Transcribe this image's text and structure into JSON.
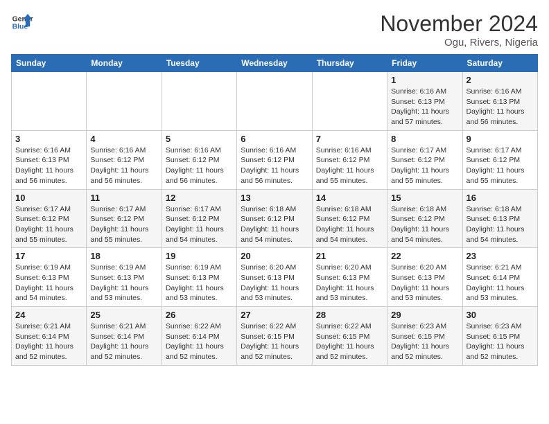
{
  "header": {
    "logo_line1": "General",
    "logo_line2": "Blue",
    "title": "November 2024",
    "subtitle": "Ogu, Rivers, Nigeria"
  },
  "weekdays": [
    "Sunday",
    "Monday",
    "Tuesday",
    "Wednesday",
    "Thursday",
    "Friday",
    "Saturday"
  ],
  "weeks": [
    [
      {
        "day": "",
        "info": ""
      },
      {
        "day": "",
        "info": ""
      },
      {
        "day": "",
        "info": ""
      },
      {
        "day": "",
        "info": ""
      },
      {
        "day": "",
        "info": ""
      },
      {
        "day": "1",
        "info": "Sunrise: 6:16 AM\nSunset: 6:13 PM\nDaylight: 11 hours and 57 minutes."
      },
      {
        "day": "2",
        "info": "Sunrise: 6:16 AM\nSunset: 6:13 PM\nDaylight: 11 hours and 56 minutes."
      }
    ],
    [
      {
        "day": "3",
        "info": "Sunrise: 6:16 AM\nSunset: 6:13 PM\nDaylight: 11 hours and 56 minutes."
      },
      {
        "day": "4",
        "info": "Sunrise: 6:16 AM\nSunset: 6:12 PM\nDaylight: 11 hours and 56 minutes."
      },
      {
        "day": "5",
        "info": "Sunrise: 6:16 AM\nSunset: 6:12 PM\nDaylight: 11 hours and 56 minutes."
      },
      {
        "day": "6",
        "info": "Sunrise: 6:16 AM\nSunset: 6:12 PM\nDaylight: 11 hours and 56 minutes."
      },
      {
        "day": "7",
        "info": "Sunrise: 6:16 AM\nSunset: 6:12 PM\nDaylight: 11 hours and 55 minutes."
      },
      {
        "day": "8",
        "info": "Sunrise: 6:17 AM\nSunset: 6:12 PM\nDaylight: 11 hours and 55 minutes."
      },
      {
        "day": "9",
        "info": "Sunrise: 6:17 AM\nSunset: 6:12 PM\nDaylight: 11 hours and 55 minutes."
      }
    ],
    [
      {
        "day": "10",
        "info": "Sunrise: 6:17 AM\nSunset: 6:12 PM\nDaylight: 11 hours and 55 minutes."
      },
      {
        "day": "11",
        "info": "Sunrise: 6:17 AM\nSunset: 6:12 PM\nDaylight: 11 hours and 55 minutes."
      },
      {
        "day": "12",
        "info": "Sunrise: 6:17 AM\nSunset: 6:12 PM\nDaylight: 11 hours and 54 minutes."
      },
      {
        "day": "13",
        "info": "Sunrise: 6:18 AM\nSunset: 6:12 PM\nDaylight: 11 hours and 54 minutes."
      },
      {
        "day": "14",
        "info": "Sunrise: 6:18 AM\nSunset: 6:12 PM\nDaylight: 11 hours and 54 minutes."
      },
      {
        "day": "15",
        "info": "Sunrise: 6:18 AM\nSunset: 6:12 PM\nDaylight: 11 hours and 54 minutes."
      },
      {
        "day": "16",
        "info": "Sunrise: 6:18 AM\nSunset: 6:13 PM\nDaylight: 11 hours and 54 minutes."
      }
    ],
    [
      {
        "day": "17",
        "info": "Sunrise: 6:19 AM\nSunset: 6:13 PM\nDaylight: 11 hours and 54 minutes."
      },
      {
        "day": "18",
        "info": "Sunrise: 6:19 AM\nSunset: 6:13 PM\nDaylight: 11 hours and 53 minutes."
      },
      {
        "day": "19",
        "info": "Sunrise: 6:19 AM\nSunset: 6:13 PM\nDaylight: 11 hours and 53 minutes."
      },
      {
        "day": "20",
        "info": "Sunrise: 6:20 AM\nSunset: 6:13 PM\nDaylight: 11 hours and 53 minutes."
      },
      {
        "day": "21",
        "info": "Sunrise: 6:20 AM\nSunset: 6:13 PM\nDaylight: 11 hours and 53 minutes."
      },
      {
        "day": "22",
        "info": "Sunrise: 6:20 AM\nSunset: 6:13 PM\nDaylight: 11 hours and 53 minutes."
      },
      {
        "day": "23",
        "info": "Sunrise: 6:21 AM\nSunset: 6:14 PM\nDaylight: 11 hours and 53 minutes."
      }
    ],
    [
      {
        "day": "24",
        "info": "Sunrise: 6:21 AM\nSunset: 6:14 PM\nDaylight: 11 hours and 52 minutes."
      },
      {
        "day": "25",
        "info": "Sunrise: 6:21 AM\nSunset: 6:14 PM\nDaylight: 11 hours and 52 minutes."
      },
      {
        "day": "26",
        "info": "Sunrise: 6:22 AM\nSunset: 6:14 PM\nDaylight: 11 hours and 52 minutes."
      },
      {
        "day": "27",
        "info": "Sunrise: 6:22 AM\nSunset: 6:15 PM\nDaylight: 11 hours and 52 minutes."
      },
      {
        "day": "28",
        "info": "Sunrise: 6:22 AM\nSunset: 6:15 PM\nDaylight: 11 hours and 52 minutes."
      },
      {
        "day": "29",
        "info": "Sunrise: 6:23 AM\nSunset: 6:15 PM\nDaylight: 11 hours and 52 minutes."
      },
      {
        "day": "30",
        "info": "Sunrise: 6:23 AM\nSunset: 6:15 PM\nDaylight: 11 hours and 52 minutes."
      }
    ]
  ]
}
